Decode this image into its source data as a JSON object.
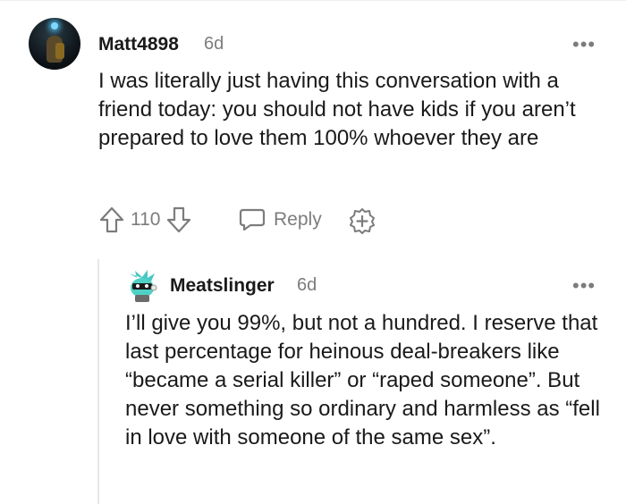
{
  "comments": [
    {
      "author": "Matt4898",
      "age": "6d",
      "text": "I was literally just having this conversation with a friend today: you should not have kids if you aren’t prepared to love them 100% whoever they are",
      "votes": "110",
      "reply_label": "Reply"
    },
    {
      "author": "Meatslinger",
      "age": "6d",
      "text": "I’ll give you 99%, but not a hundred. I reserve that last percentage for heinous deal-breakers like “became a serial killer” or “raped someone”. But never something so ordinary and harmless as “fell in love with someone of the same sex”."
    }
  ],
  "more_glyph": "•••"
}
